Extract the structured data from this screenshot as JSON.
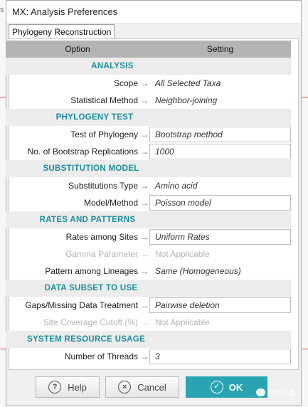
{
  "window": {
    "title": "MX: Analysis Preferences"
  },
  "tab": {
    "label": "Phylogeny Reconstruction"
  },
  "grid": {
    "option_header": "Option",
    "setting_header": "Setting"
  },
  "sections": {
    "analysis": "ANALYSIS",
    "phylogeny_test": "PHYLOGENY TEST",
    "substitution_model": "SUBSTITUTION MODEL",
    "rates_patterns": "RATES AND PATTERNS",
    "data_subset": "DATA SUBSET TO USE",
    "system_resource": "SYSTEM RESOURCE USAGE"
  },
  "rows": {
    "scope": {
      "label": "Scope",
      "value": "All Selected Taxa"
    },
    "statistical_method": {
      "label": "Statistical Method",
      "value": "Neighbor-joining"
    },
    "test_of_phylogeny": {
      "label": "Test of Phylogeny",
      "value": "Bootstrap method"
    },
    "bootstrap_replications": {
      "label": "No. of Bootstrap Replications",
      "value": "1000"
    },
    "substitutions_type": {
      "label": "Substitutions Type",
      "value": "Amino acid"
    },
    "model_method": {
      "label": "Model/Method",
      "value": "Poisson model"
    },
    "rates_among_sites": {
      "label": "Rates among Sites",
      "value": "Uniform Rates"
    },
    "gamma_parameter": {
      "label": "Gamma Parameter",
      "value": "Not Applicable"
    },
    "pattern_among_lineages": {
      "label": "Pattern among Lineages",
      "value": "Same (Homogeneous)"
    },
    "gaps_missing": {
      "label": "Gaps/Missing Data Treatment",
      "value": "Pairwise deletion"
    },
    "site_coverage": {
      "label": "Site Coverage Cutoff (%)",
      "value": "Not Applicable"
    },
    "threads": {
      "label": "Number of Threads",
      "value": "3"
    }
  },
  "arrow_glyph": "→",
  "buttons": {
    "help": {
      "label": "Help",
      "icon": "?"
    },
    "cancel": {
      "label": "Cancel",
      "icon": "×"
    },
    "ok": {
      "label": "OK",
      "icon": "✓"
    }
  },
  "watermark": {
    "text": "今日之森"
  },
  "background": {
    "left_char": "s"
  },
  "colors": {
    "section_text": "#1a8e9e",
    "ok_button": "#2aa4b2",
    "header_bg": "#b4b4b4"
  }
}
